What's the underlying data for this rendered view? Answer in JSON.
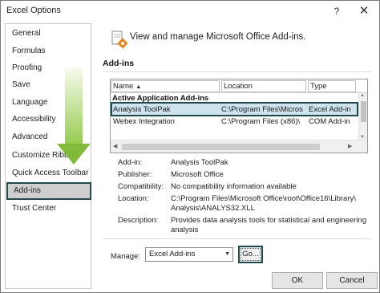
{
  "window": {
    "title": "Excel Options",
    "help_glyph": "?",
    "close_glyph": "✕"
  },
  "nav": {
    "items": [
      {
        "label": "General"
      },
      {
        "label": "Formulas"
      },
      {
        "label": "Proofing"
      },
      {
        "label": "Save"
      },
      {
        "label": "Language"
      },
      {
        "label": "Accessibility"
      },
      {
        "label": "Advanced"
      },
      {
        "label": "Customize Ribbon"
      },
      {
        "label": "Quick Access Toolbar"
      },
      {
        "label": "Add-ins",
        "selected": true
      },
      {
        "label": "Trust Center"
      }
    ]
  },
  "main": {
    "header_icon": "gear-puzzle-icon",
    "header_text": "View and manage Microsoft Office Add-ins.",
    "section_title": "Add-ins"
  },
  "addins_list": {
    "columns": [
      "Name",
      "Location",
      "Type"
    ],
    "sort_glyph": "▲",
    "group_title": "Active Application Add-ins",
    "rows": [
      {
        "name": "Analysis ToolPak",
        "location": "C:\\Program Files\\Micros",
        "type": "Excel Add-in",
        "selected": true
      },
      {
        "name": "Webex Integration",
        "location": "C:\\Program Files (x86)\\",
        "type": "COM Add-in"
      }
    ]
  },
  "details": {
    "addin_label": "Add-in:",
    "addin_value": "Analysis ToolPak",
    "publisher_label": "Publisher:",
    "publisher_value": "Microsoft Office",
    "compat_label": "Compatibility:",
    "compat_value": "No compatibility information available",
    "location_label": "Location:",
    "location_value": "C:\\Program Files\\Microsoft Office\\root\\Office16\\Library\\ Analysis\\ANALYS32.XLL",
    "description_label": "Description:",
    "description_value": "Provides data analysis tools for statistical and engineering analysis"
  },
  "manage": {
    "label": "Manage:",
    "selected_option": "Excel Add-ins",
    "go_label": "Go..."
  },
  "footer": {
    "ok_label": "OK",
    "cancel_label": "Cancel"
  },
  "colors": {
    "selection_border": "#1f4a4a",
    "row_highlight": "#cde4ee",
    "arrow_green": "#8dc63f",
    "nav_selected_bg": "#cfcfcf"
  }
}
